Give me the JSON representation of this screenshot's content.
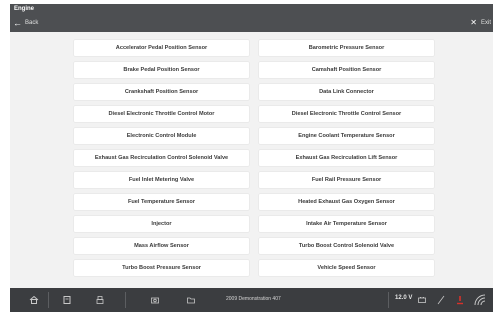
{
  "header": {
    "title": "Engine",
    "back_label": "Back",
    "exit_label": "Exit"
  },
  "sensors": {
    "items": [
      "Accelerator Pedal Position Sensor",
      "Barometric Pressure Sensor",
      "Brake Pedal Position Sensor",
      "Camshaft Position Sensor",
      "Crankshaft Position Sensor",
      "Data Link Connector",
      "Diesel Electronic Throttle Control Motor",
      "Diesel Electronic Throttle Control Sensor",
      "Electronic Control Module",
      "Engine Coolant Temperature Sensor",
      "Exhaust Gas Recirculation Control Solenoid Valve",
      "Exhaust Gas Recirculation Lift Sensor",
      "Fuel Inlet Metering Valve",
      "Fuel Rail Pressure Sensor",
      "Fuel Temperature Sensor",
      "Heated Exhaust Gas Oxygen Sensor",
      "Injector",
      "Intake Air Temperature Sensor",
      "Mass Airflow Sensor",
      "Turbo Boost Control Solenoid Valve",
      "Turbo Boost Pressure Sensor",
      "Vehicle Speed Sensor"
    ]
  },
  "footer": {
    "vehicle": "2009 Demonstration 407",
    "voltage": "12.0 V",
    "icons": [
      "home-icon",
      "save-icon",
      "print-icon",
      "snapshot-icon",
      "folder-icon",
      "battery-icon",
      "scope-icon",
      "alert-icon",
      "wifi-icon"
    ]
  },
  "colors": {
    "header_bg": "#4d4f52",
    "content_bg": "#f2f2f2",
    "footer_bg": "#3b3d40",
    "alert": "#d8312a"
  }
}
